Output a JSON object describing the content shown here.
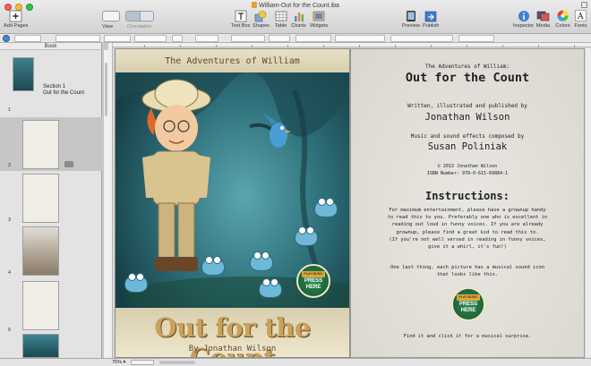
{
  "window": {
    "title": "William-Out for the Count.iba"
  },
  "toolbar": {
    "add_pages": "Add Pages",
    "view": "View",
    "orientation": "Orientation",
    "text_box": "Text Box",
    "shapes": "Shapes",
    "table": "Table",
    "charts": "Charts",
    "widgets": "Widgets",
    "preview": "Preview",
    "publish": "Publish",
    "inspector": "Inspector",
    "media": "Media",
    "colors": "Colors",
    "fonts": "Fonts"
  },
  "sidebar": {
    "header": "Book",
    "section_label": "Section 1",
    "section_title": "Out for the Count",
    "pages": [
      "1",
      "2",
      "3",
      "4",
      "5"
    ]
  },
  "cover": {
    "subtitle": "The Adventures of William",
    "title": "Out for the Count",
    "author": "By Jonathan Wilson",
    "press_top": "PLAY MUSIC",
    "press_line1": "PRESS",
    "press_line2": "HERE"
  },
  "title_page": {
    "series": "The Adventures of William:",
    "title": "Out for the Count",
    "credit1": "Written, illustrated and published by",
    "author": "Jonathan Wilson",
    "credit2": "Music and sound effects composed by",
    "composer": "Susan Poliniak",
    "copyright": "© 2013 Jonathan Wilson",
    "isbn": "ISBN Number: 978-0-615-69884-1",
    "instructions_heading": "Instructions:",
    "para1_l1": "For maximum entertainment, please have a grownup handy",
    "para1_l2": "to read this to you. Preferably one who is excellent in",
    "para1_l3": "reading out loud in funny voices. If you are already",
    "para1_l4": "grownup, please find a great kid to read this to.",
    "para1_l5": "(If you're not well versed in reading in funny voices,",
    "para1_l6": "give it a whirl, it's fun!)",
    "para2_l1": "One last thing, each picture has a musical sound icon",
    "para2_l2": "that looks like this.",
    "footer": "Find it and click it for a musical surprise."
  },
  "status": {
    "zoom": "75%"
  }
}
